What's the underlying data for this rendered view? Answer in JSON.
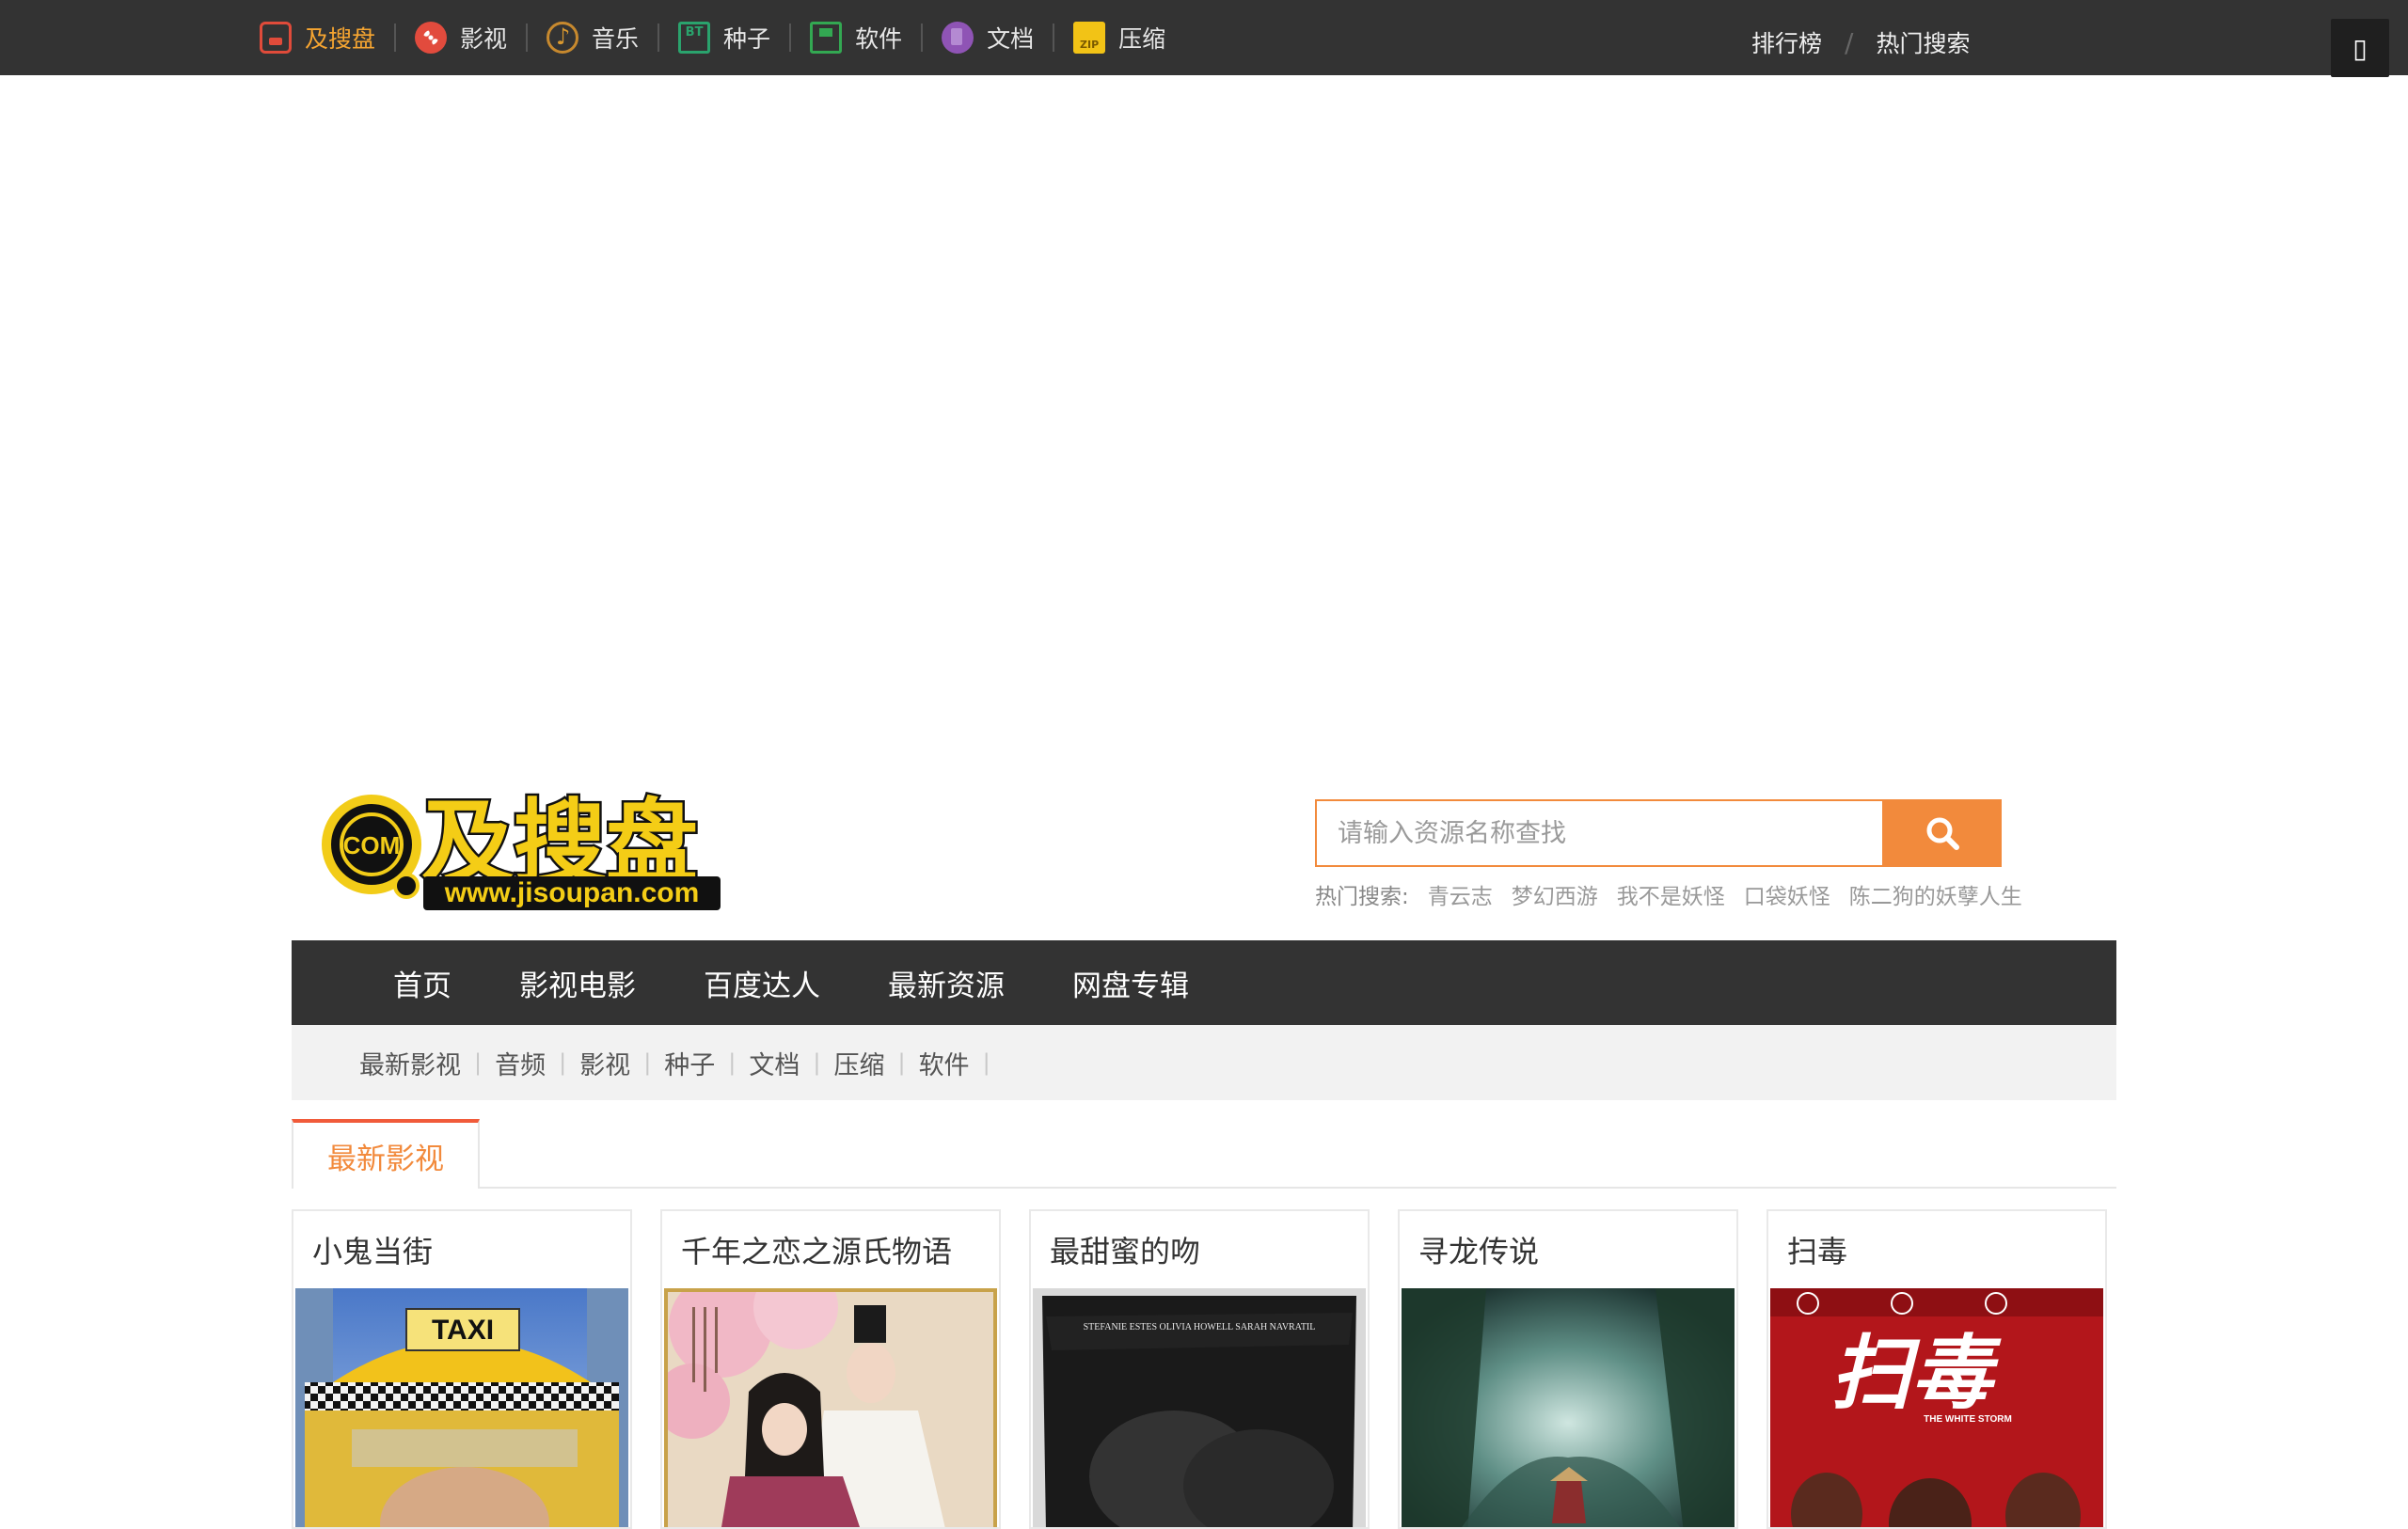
{
  "topnav": {
    "items": [
      {
        "label": "及搜盘",
        "icon": "disk-icon",
        "active": true
      },
      {
        "label": "影视",
        "icon": "film-reel-icon"
      },
      {
        "label": "音乐",
        "icon": "music-note-icon"
      },
      {
        "label": "种子",
        "icon": "bt-torrent-icon"
      },
      {
        "label": "软件",
        "icon": "software-save-icon"
      },
      {
        "label": "文档",
        "icon": "document-icon"
      },
      {
        "label": "压缩",
        "icon": "zip-archive-icon"
      }
    ],
    "right": {
      "rank": "排行榜",
      "hot": "热门搜索"
    },
    "corner_icon": "square-glyph-icon"
  },
  "logo": {
    "text": "及搜盘",
    "url_text": "www.jisoupan.com",
    "badge": "COM"
  },
  "search": {
    "placeholder": "请输入资源名称查找",
    "hot_label": "热门搜索:",
    "hot_terms": [
      "青云志",
      "梦幻西游",
      "我不是妖怪",
      "口袋妖怪",
      "陈二狗的妖孽人生"
    ]
  },
  "mainnav": [
    "首页",
    "影视电影",
    "百度达人",
    "最新资源",
    "网盘专辑"
  ],
  "subnav": [
    "最新影视",
    "音频",
    "影视",
    "种子",
    "文档",
    "压缩",
    "软件"
  ],
  "tab": {
    "label": "最新影视"
  },
  "cards": [
    {
      "title": "小鬼当街",
      "poster_text": "TAXI"
    },
    {
      "title": "千年之恋之源氏物语",
      "poster_text": ""
    },
    {
      "title": "最甜蜜的吻",
      "poster_text": "STEFANIE ESTES     OLIVIA HOWELL     SARAH NAVRATIL"
    },
    {
      "title": "寻龙传说",
      "poster_text": ""
    },
    {
      "title": "扫毒",
      "poster_text": "扫毒",
      "poster_sub": "THE WHITE STORM"
    }
  ],
  "colors": {
    "accent": "#f28a3c",
    "topbar": "#333333",
    "tab_top": "#f15b3a"
  }
}
